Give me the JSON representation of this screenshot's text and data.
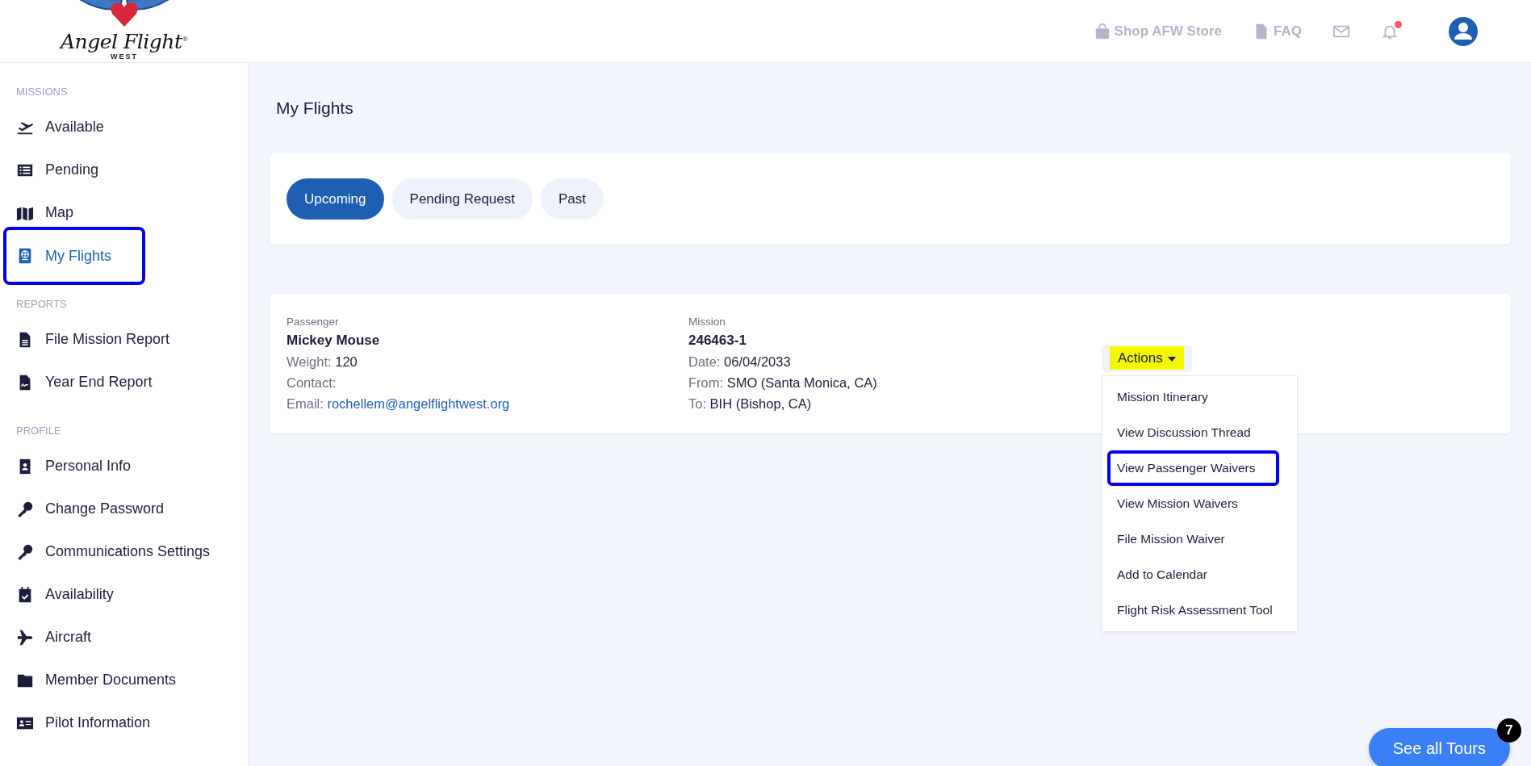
{
  "logo": {
    "name": "Angel Flight",
    "mark": "®",
    "sub": "WEST"
  },
  "header": {
    "links": [
      {
        "kind": "bag",
        "label": "Shop AFW Store"
      },
      {
        "kind": "file",
        "label": "FAQ"
      },
      {
        "kind": "mail"
      },
      {
        "kind": "bell",
        "alert": true
      }
    ]
  },
  "sidebar": {
    "sections": [
      {
        "title": "MISSIONS",
        "items": [
          {
            "kind": "takeoff",
            "label": "Available",
            "selected": false,
            "annotated": false
          },
          {
            "kind": "list",
            "label": "Pending",
            "selected": false,
            "annotated": false
          },
          {
            "kind": "map",
            "label": "Map",
            "selected": false,
            "annotated": false
          },
          {
            "kind": "passport",
            "label": "My Flights",
            "selected": true,
            "annotated": true
          }
        ]
      },
      {
        "title": "REPORTS",
        "items": [
          {
            "kind": "doc",
            "label": "File Mission Report",
            "selected": false,
            "annotated": false
          },
          {
            "kind": "chart",
            "label": "Year End Report",
            "selected": false,
            "annotated": false
          }
        ]
      },
      {
        "title": "PROFILE",
        "items": [
          {
            "kind": "badge",
            "label": "Personal Info",
            "selected": false,
            "annotated": false
          },
          {
            "kind": "key",
            "label": "Change Password",
            "selected": false,
            "annotated": false
          },
          {
            "kind": "key",
            "label": "Communications Settings",
            "selected": false,
            "annotated": false
          },
          {
            "kind": "calendar",
            "label": "Availability",
            "selected": false,
            "annotated": false
          },
          {
            "kind": "plane",
            "label": "Aircraft",
            "selected": false,
            "annotated": false
          },
          {
            "kind": "folder",
            "label": "Member Documents",
            "selected": false,
            "annotated": false
          },
          {
            "kind": "idcard",
            "label": "Pilot Information",
            "selected": false,
            "annotated": false
          }
        ]
      }
    ]
  },
  "page_title": "My Flights",
  "tabs": [
    {
      "label": "Upcoming",
      "selected": true
    },
    {
      "label": "Pending Request",
      "selected": false
    },
    {
      "label": "Past",
      "selected": false
    }
  ],
  "flight": {
    "passenger": {
      "heading": "Passenger",
      "name": "Mickey Mouse",
      "fields": [
        {
          "label": "Weight:",
          "value": "120"
        },
        {
          "label": "Contact:"
        },
        {
          "label": "Email:",
          "value": "rochellem@angelflightwest.org",
          "kind": "link"
        }
      ]
    },
    "mission": {
      "heading": "Mission",
      "id": "246463-1",
      "fields": [
        {
          "label": "Date:",
          "value": "06/04/2033"
        },
        {
          "label": "From:",
          "value": "SMO (Santa Monica, CA)"
        },
        {
          "label": "To:",
          "value": "BIH (Bishop, CA)"
        }
      ]
    },
    "actions": {
      "label": "Actions",
      "highlighted": true,
      "menu": [
        {
          "label": "Mission Itinerary",
          "annotated": false
        },
        {
          "label": "View Discussion Thread",
          "annotated": false
        },
        {
          "label": "View Passenger Waivers",
          "annotated": true
        },
        {
          "label": "View Mission Waivers",
          "annotated": false
        },
        {
          "label": "File Mission Waiver",
          "annotated": false
        },
        {
          "label": "Add to Calendar",
          "annotated": false
        },
        {
          "label": "Flight Risk Assessment Tool",
          "annotated": false
        }
      ]
    }
  },
  "tours": {
    "label": "See all Tours",
    "count": "7"
  }
}
